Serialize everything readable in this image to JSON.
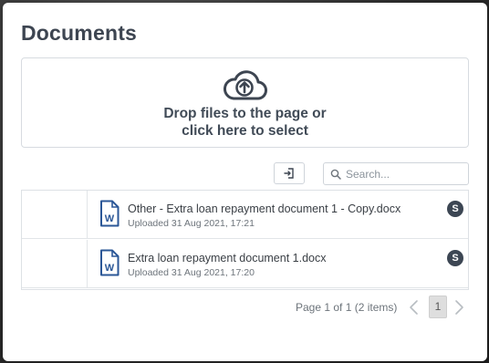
{
  "dialog": {
    "title": "Documents"
  },
  "dropzone": {
    "line1": "Drop files to the page or",
    "line2": "click here to select",
    "icon": "cloud-upload-icon"
  },
  "toolbar": {
    "action_icon": "sign-in-icon",
    "search_placeholder": "Search..."
  },
  "documents": [
    {
      "name": "Other - Extra loan repayment document 1 - Copy.docx",
      "uploaded": "Uploaded 31 Aug 2021, 17:21",
      "avatar": "S",
      "icon": "word-document-icon"
    },
    {
      "name": "Extra loan repayment document 1.docx",
      "uploaded": "Uploaded 31 Aug 2021, 17:20",
      "avatar": "S",
      "icon": "word-document-icon"
    }
  ],
  "pager": {
    "summary": "Page 1 of 1 (2 items)",
    "current_page": "1"
  },
  "colors": {
    "title": "#3d4551",
    "avatar_bg": "#3c4653",
    "word_icon": "#2b5797",
    "border": "#d7dbe0"
  }
}
